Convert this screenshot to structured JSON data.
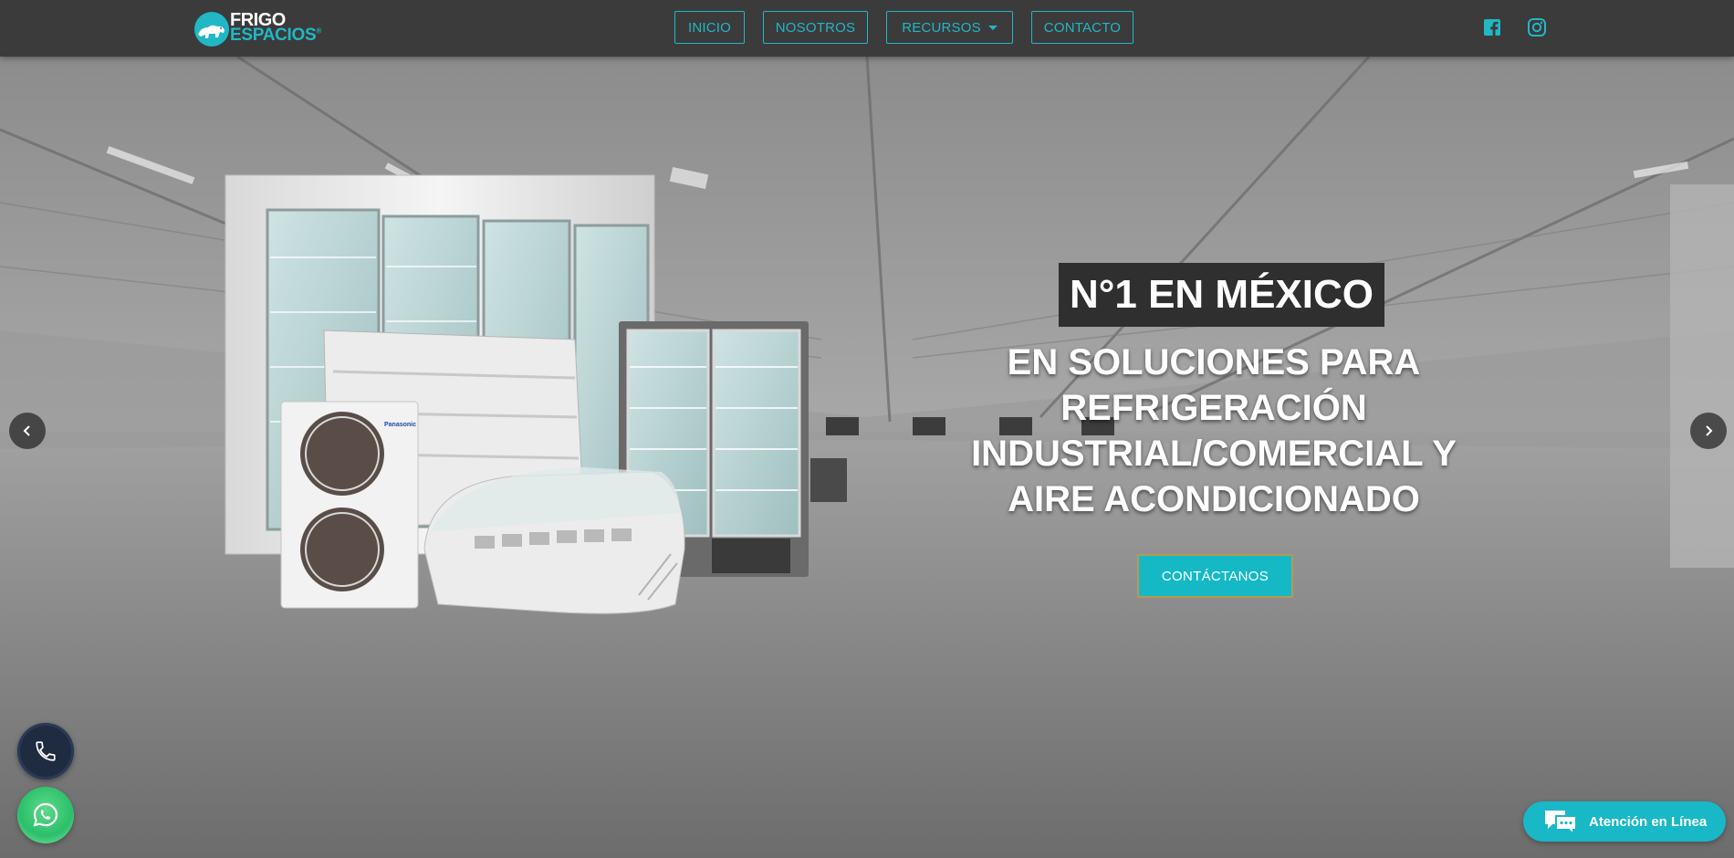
{
  "header": {
    "logo": {
      "line1": "FRIGO",
      "line2": "ESPACIOS",
      "mark": "®"
    },
    "nav": [
      {
        "label": "INICIO"
      },
      {
        "label": "NOSOTROS"
      },
      {
        "label": "RECURSOS",
        "has_dropdown": true
      },
      {
        "label": "CONTACTO"
      }
    ],
    "social": [
      {
        "icon": "facebook-icon"
      },
      {
        "icon": "instagram-icon"
      }
    ],
    "colors": {
      "bar": "#3b3b3b",
      "accent": "#21b7c5"
    }
  },
  "hero": {
    "badge": "N°1 EN MÉXICO",
    "headline": "EN SOLUCIONES PARA REFRIGERACIÓN INDUSTRIAL/COMERCIAL Y AIRE ACONDICIONADO",
    "cta": "CONTÁCTANOS",
    "product_brand": "Panasonic",
    "arrows": {
      "prev_icon": "chevron-left-icon",
      "next_icon": "chevron-right-icon"
    }
  },
  "widgets": {
    "phone_icon": "phone-icon",
    "whatsapp_icon": "whatsapp-icon",
    "chat": {
      "icon": "chat-bubbles-icon",
      "label": "Atención en Línea"
    },
    "colors": {
      "cta": "#15b9c6",
      "phone": "#1f2b40",
      "whatsapp": "#2bbf6a"
    }
  }
}
